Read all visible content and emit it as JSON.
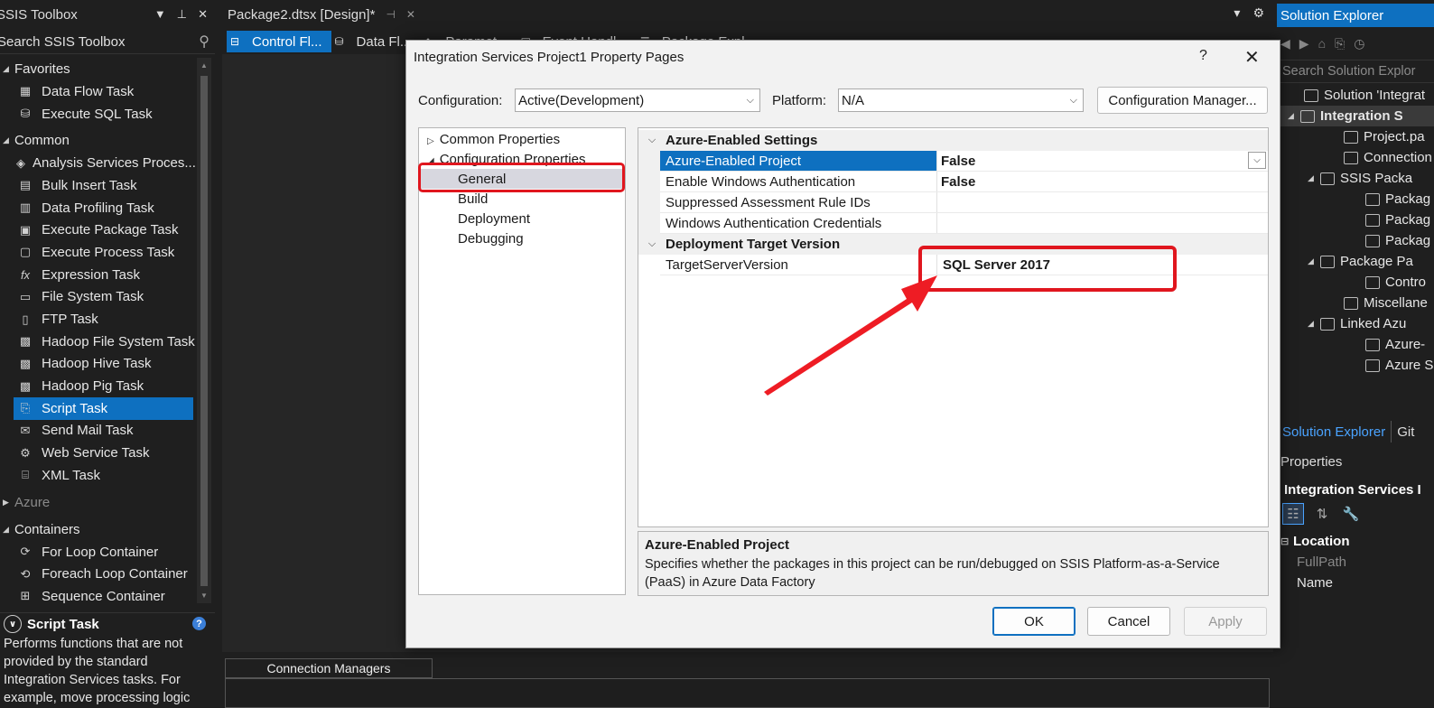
{
  "toolbox": {
    "title": "SSIS Toolbox",
    "search_placeholder": "Search SSIS Toolbox",
    "favorites_label": "Favorites",
    "favorites": [
      "Data Flow Task",
      "Execute SQL Task"
    ],
    "common_label": "Common",
    "common": [
      "Analysis Services Proces...",
      "Bulk Insert Task",
      "Data Profiling Task",
      "Execute Package Task",
      "Execute Process Task",
      "Expression Task",
      "File System Task",
      "FTP Task",
      "Hadoop File System Task",
      "Hadoop Hive Task",
      "Hadoop Pig Task",
      "Script Task",
      "Send Mail Task",
      "Web Service Task",
      "XML Task"
    ],
    "azure_label": "Azure",
    "containers_label": "Containers",
    "containers": [
      "For Loop Container",
      "Foreach Loop Container",
      "Sequence Container"
    ],
    "desc_title": "Script Task",
    "desc_text": "Performs functions that are not provided by the standard Integration Services tasks. For example, move processing logic"
  },
  "designer": {
    "doc_tab": "Package2.dtsx [Design]*",
    "tabs": [
      "Control Fl...",
      "Data Fl...",
      "Paramet...",
      "Event Handl...",
      "Package Expl..."
    ],
    "connection_managers": "Connection Managers"
  },
  "solution": {
    "title": "Solution Explorer",
    "search_placeholder": "Search Solution Explor",
    "nodes": [
      {
        "label": "Solution 'Integrat",
        "indent": 16,
        "tri": ""
      },
      {
        "label": "Integration S",
        "indent": 12,
        "tri": "◢",
        "bold": true
      },
      {
        "label": "Project.pa",
        "indent": 60,
        "tri": ""
      },
      {
        "label": "Connection",
        "indent": 60,
        "tri": ""
      },
      {
        "label": "SSIS Packa",
        "indent": 34,
        "tri": "◢"
      },
      {
        "label": "Packag",
        "indent": 84,
        "tri": ""
      },
      {
        "label": "Packag",
        "indent": 84,
        "tri": ""
      },
      {
        "label": "Packag",
        "indent": 84,
        "tri": ""
      },
      {
        "label": "Package Pa",
        "indent": 34,
        "tri": "◢"
      },
      {
        "label": "Contro",
        "indent": 84,
        "tri": ""
      },
      {
        "label": "Miscellane",
        "indent": 60,
        "tri": ""
      },
      {
        "label": "Linked Azu",
        "indent": 34,
        "tri": "◢"
      },
      {
        "label": "Azure-",
        "indent": 84,
        "tri": ""
      },
      {
        "label": "Azure S",
        "indent": 84,
        "tri": ""
      }
    ],
    "tab_solution": "Solution Explorer",
    "tab_git": "Git",
    "properties_title": "Properties",
    "properties_object": "Integration Services I",
    "properties_category": "Location",
    "prop_fullpath": "FullPath",
    "prop_name": "Name"
  },
  "dialog": {
    "title": "Integration Services Project1 Property Pages",
    "help": "?",
    "close": "✕",
    "configuration_label": "Configuration:",
    "configuration_value": "Active(Development)",
    "platform_label": "Platform:",
    "platform_value": "N/A",
    "config_manager_button": "Configuration Manager...",
    "tree": {
      "common": "Common Properties",
      "config": "Configuration Properties",
      "general": "General",
      "build": "Build",
      "deployment": "Deployment",
      "debugging": "Debugging"
    },
    "grid": {
      "cat1": "Azure-Enabled Settings",
      "rows1": [
        {
          "key": "Azure-Enabled Project",
          "value": "False"
        },
        {
          "key": "Enable Windows Authentication",
          "value": "False"
        },
        {
          "key": "Suppressed Assessment Rule IDs",
          "value": ""
        },
        {
          "key": "Windows Authentication Credentials",
          "value": ""
        }
      ],
      "cat2": "Deployment Target Version",
      "rows2": [
        {
          "key": "TargetServerVersion",
          "value": "SQL Server 2017"
        }
      ]
    },
    "description_title": "Azure-Enabled Project",
    "description_text": "Specifies whether the packages in this project can be run/debugged on SSIS Platform-as-a-Service (PaaS) in Azure Data Factory",
    "ok": "OK",
    "cancel": "Cancel",
    "apply": "Apply"
  },
  "colors": {
    "accent": "#0e70c0",
    "highlight": "#e0161e"
  }
}
